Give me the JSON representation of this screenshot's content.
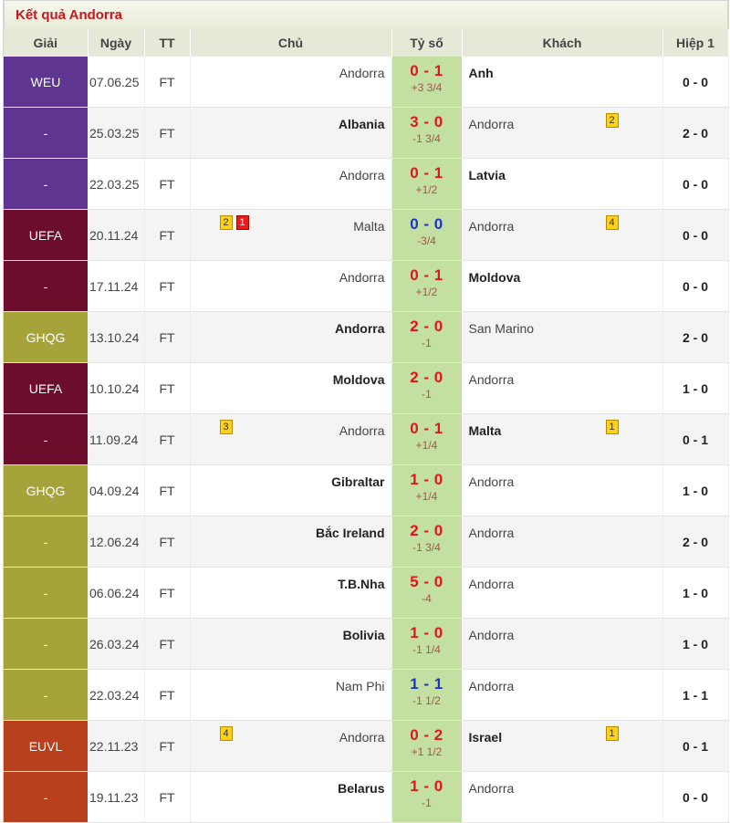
{
  "title": "Kết quả Andorra",
  "headers": {
    "league": "Giải",
    "date": "Ngày",
    "status": "TT",
    "home": "Chủ",
    "score": "Tỷ số",
    "away": "Khách",
    "half": "Hiệp 1"
  },
  "colors": {
    "purple": "#5e3590",
    "maroon": "#6b0d2b",
    "olive": "#a5a33a",
    "rust": "#b8401c",
    "score_bg": "#c3e0a2",
    "score_red": "#e1151b",
    "score_blue": "#1a33c9"
  },
  "matches": [
    {
      "league": "WEU",
      "league_color": "#5e3590",
      "date": "07.06.25",
      "status": "FT",
      "home": "Andorra",
      "home_bold": false,
      "score": "0 - 1",
      "score_color": "red",
      "handicap": "+3 3/4",
      "away": "Anh",
      "away_bold": true,
      "half": "0 - 0",
      "home_cards": [],
      "away_cards": []
    },
    {
      "league": "-",
      "league_color": "#5e3590",
      "date": "25.03.25",
      "status": "FT",
      "home": "Albania",
      "home_bold": true,
      "score": "3 - 0",
      "score_color": "red",
      "handicap": "-1 3/4",
      "away": "Andorra",
      "away_bold": false,
      "half": "2 - 0",
      "home_cards": [],
      "away_cards": [
        {
          "n": "2",
          "type": "yellow"
        }
      ]
    },
    {
      "league": "-",
      "league_color": "#5e3590",
      "date": "22.03.25",
      "status": "FT",
      "home": "Andorra",
      "home_bold": false,
      "score": "0 - 1",
      "score_color": "red",
      "handicap": "+1/2",
      "away": "Latvia",
      "away_bold": true,
      "half": "0 - 0",
      "home_cards": [],
      "away_cards": []
    },
    {
      "league": "UEFA",
      "league_color": "#6b0d2b",
      "date": "20.11.24",
      "status": "FT",
      "home": "Malta",
      "home_bold": false,
      "score": "0 - 0",
      "score_color": "blue",
      "handicap": "-3/4",
      "away": "Andorra",
      "away_bold": false,
      "half": "0 - 0",
      "home_cards": [
        {
          "n": "2",
          "type": "yellow"
        },
        {
          "n": "1",
          "type": "red"
        }
      ],
      "away_cards": [
        {
          "n": "4",
          "type": "yellow"
        }
      ]
    },
    {
      "league": "-",
      "league_color": "#6b0d2b",
      "date": "17.11.24",
      "status": "FT",
      "home": "Andorra",
      "home_bold": false,
      "score": "0 - 1",
      "score_color": "red",
      "handicap": "+1/2",
      "away": "Moldova",
      "away_bold": true,
      "half": "0 - 0",
      "home_cards": [],
      "away_cards": []
    },
    {
      "league": "GHQG",
      "league_color": "#a5a33a",
      "date": "13.10.24",
      "status": "FT",
      "home": "Andorra",
      "home_bold": true,
      "score": "2 - 0",
      "score_color": "red",
      "handicap": "-1",
      "away": "San Marino",
      "away_bold": false,
      "half": "2 - 0",
      "home_cards": [],
      "away_cards": []
    },
    {
      "league": "UEFA",
      "league_color": "#6b0d2b",
      "date": "10.10.24",
      "status": "FT",
      "home": "Moldova",
      "home_bold": true,
      "score": "2 - 0",
      "score_color": "red",
      "handicap": "-1",
      "away": "Andorra",
      "away_bold": false,
      "half": "1 - 0",
      "home_cards": [],
      "away_cards": []
    },
    {
      "league": "-",
      "league_color": "#6b0d2b",
      "date": "11.09.24",
      "status": "FT",
      "home": "Andorra",
      "home_bold": false,
      "score": "0 - 1",
      "score_color": "red",
      "handicap": "+1/4",
      "away": "Malta",
      "away_bold": true,
      "half": "0 - 1",
      "home_cards": [
        {
          "n": "3",
          "type": "yellow"
        }
      ],
      "away_cards": [
        {
          "n": "1",
          "type": "yellow"
        }
      ]
    },
    {
      "league": "GHQG",
      "league_color": "#a5a33a",
      "date": "04.09.24",
      "status": "FT",
      "home": "Gibraltar",
      "home_bold": true,
      "score": "1 - 0",
      "score_color": "red",
      "handicap": "+1/4",
      "away": "Andorra",
      "away_bold": false,
      "half": "1 - 0",
      "home_cards": [],
      "away_cards": []
    },
    {
      "league": "-",
      "league_color": "#a5a33a",
      "date": "12.06.24",
      "status": "FT",
      "home": "Bắc Ireland",
      "home_bold": true,
      "score": "2 - 0",
      "score_color": "red",
      "handicap": "-1 3/4",
      "away": "Andorra",
      "away_bold": false,
      "half": "2 - 0",
      "home_cards": [],
      "away_cards": []
    },
    {
      "league": "-",
      "league_color": "#a5a33a",
      "date": "06.06.24",
      "status": "FT",
      "home": "T.B.Nha",
      "home_bold": true,
      "score": "5 - 0",
      "score_color": "red",
      "handicap": "-4",
      "away": "Andorra",
      "away_bold": false,
      "half": "1 - 0",
      "home_cards": [],
      "away_cards": []
    },
    {
      "league": "-",
      "league_color": "#a5a33a",
      "date": "26.03.24",
      "status": "FT",
      "home": "Bolivia",
      "home_bold": true,
      "score": "1 - 0",
      "score_color": "red",
      "handicap": "-1 1/4",
      "away": "Andorra",
      "away_bold": false,
      "half": "1 - 0",
      "home_cards": [],
      "away_cards": []
    },
    {
      "league": "-",
      "league_color": "#a5a33a",
      "date": "22.03.24",
      "status": "FT",
      "home": "Nam Phi",
      "home_bold": false,
      "score": "1 - 1",
      "score_color": "blue",
      "handicap": "-1 1/2",
      "away": "Andorra",
      "away_bold": false,
      "half": "1 - 1",
      "home_cards": [],
      "away_cards": []
    },
    {
      "league": "EUVL",
      "league_color": "#b8401c",
      "date": "22.11.23",
      "status": "FT",
      "home": "Andorra",
      "home_bold": false,
      "score": "0 - 2",
      "score_color": "red",
      "handicap": "+1 1/2",
      "away": "Israel",
      "away_bold": true,
      "half": "0 - 1",
      "home_cards": [
        {
          "n": "4",
          "type": "yellow"
        }
      ],
      "away_cards": [
        {
          "n": "1",
          "type": "yellow"
        }
      ]
    },
    {
      "league": "-",
      "league_color": "#b8401c",
      "date": "19.11.23",
      "status": "FT",
      "home": "Belarus",
      "home_bold": true,
      "score": "1 - 0",
      "score_color": "red",
      "handicap": "-1",
      "away": "Andorra",
      "away_bold": false,
      "half": "0 - 0",
      "home_cards": [],
      "away_cards": []
    }
  ]
}
